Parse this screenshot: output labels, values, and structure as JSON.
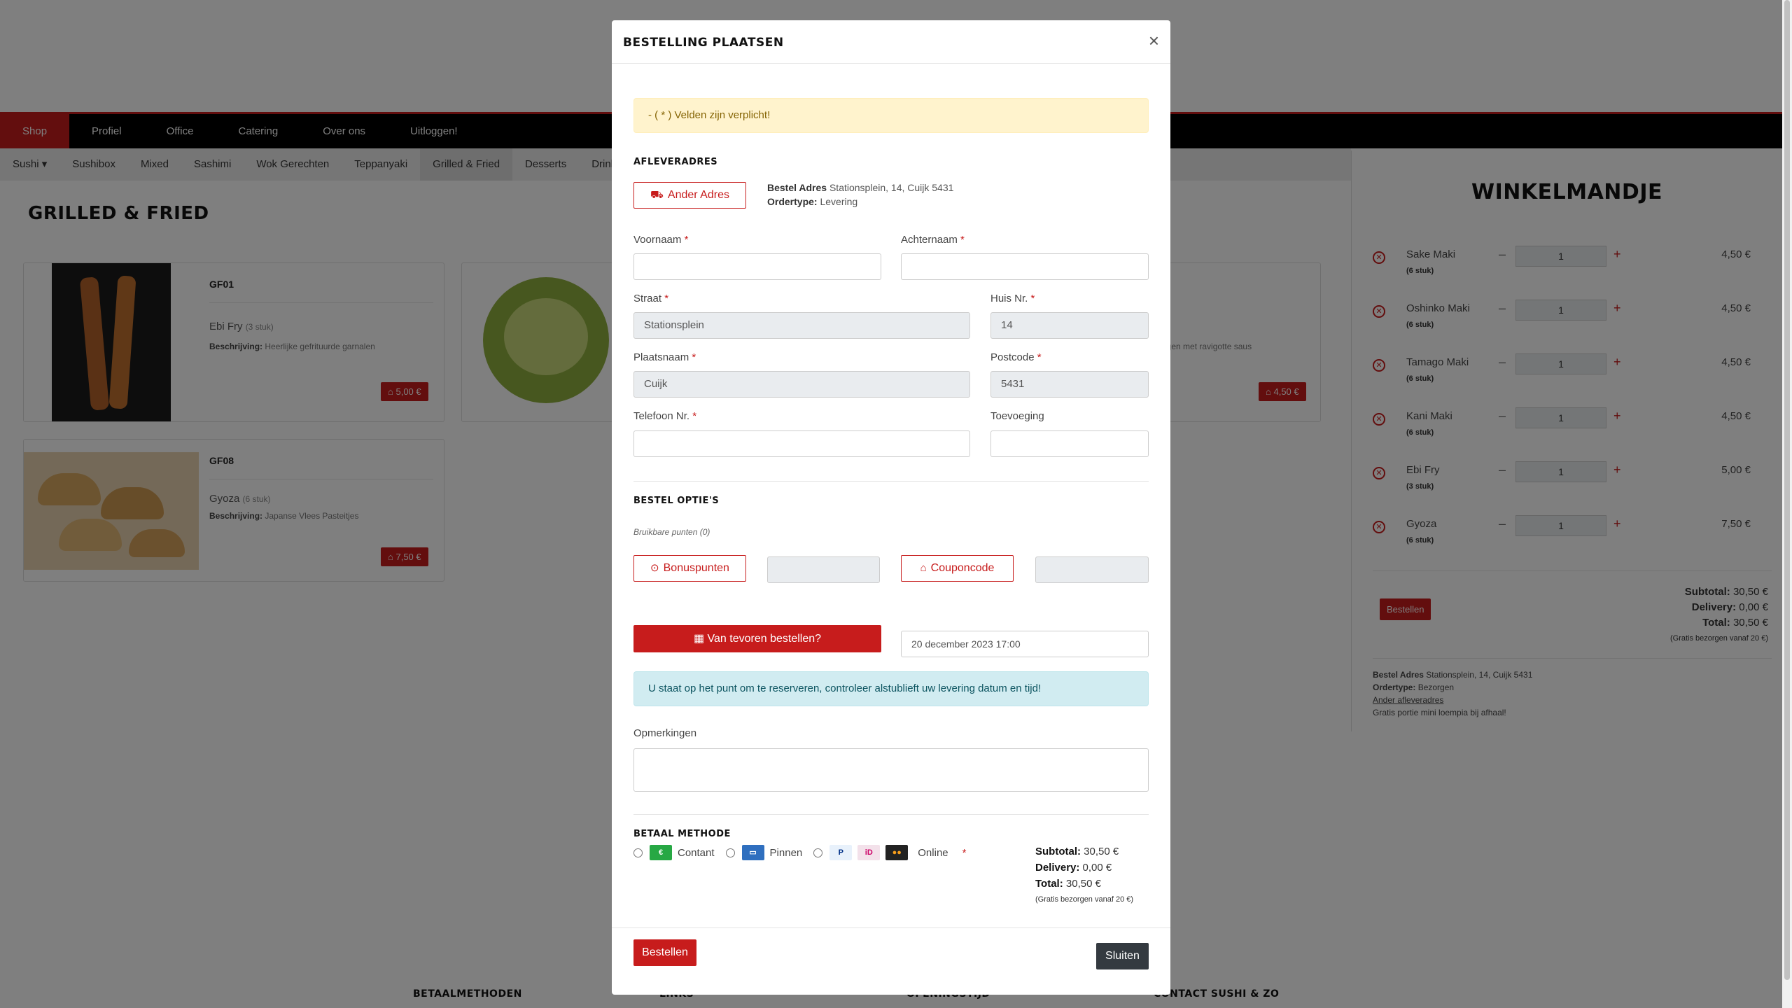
{
  "topnav": [
    "Shop",
    "Profiel",
    "Office",
    "Catering",
    "Over ons",
    "Uitloggen!"
  ],
  "subnav": [
    "Sushi",
    "Sushibox",
    "Mixed",
    "Sashimi",
    "Wok Gerechten",
    "Teppanyaki",
    "Grilled & Fried",
    "Desserts",
    "Drink"
  ],
  "page_title": "GRILLED & FRIED",
  "products": [
    {
      "code": "GF01",
      "name": "Ebi Fry",
      "size": "(3 stuk)",
      "desc_label": "Beschrijving:",
      "desc": "Heerlijke gefrituurde garnalen",
      "price": "5,00 €"
    },
    {
      "code": "GF08",
      "name": "Gyoza",
      "size": "(6 stuk)",
      "desc_label": "Beschrijving:",
      "desc": "Japanse Vlees Pasteitjes",
      "price": "7,50 €"
    },
    {
      "partial_desc": "ngen met ravigotte saus",
      "price": "4,50 €"
    }
  ],
  "cart": {
    "title": "WINKELMANDJE",
    "items": [
      {
        "name": "Sake Maki",
        "size": "(6 stuk)",
        "qty": "1",
        "price": "4,50 €"
      },
      {
        "name": "Oshinko Maki",
        "size": "(6 stuk)",
        "qty": "1",
        "price": "4,50 €"
      },
      {
        "name": "Tamago Maki",
        "size": "(6 stuk)",
        "qty": "1",
        "price": "4,50 €"
      },
      {
        "name": "Kani Maki",
        "size": "(6 stuk)",
        "qty": "1",
        "price": "4,50 €"
      },
      {
        "name": "Ebi Fry",
        "size": "(3 stuk)",
        "qty": "1",
        "price": "5,00 €"
      },
      {
        "name": "Gyoza",
        "size": "(6 stuk)",
        "qty": "1",
        "price": "7,50 €"
      }
    ],
    "order_label": "Bestellen",
    "subtotal_label": "Subtotal:",
    "subtotal": "30,50 €",
    "delivery_label": "Delivery:",
    "delivery": "0,00 €",
    "total_label": "Total:",
    "total": "30,50 €",
    "free_note": "(Gratis bezorgen vanaf 20 €)",
    "addr_label": "Bestel Adres",
    "addr": "Stationsplein, 14, Cuijk 5431",
    "type_label": "Ordertype:",
    "type": "Bezorgen",
    "other_addr": "Ander afleveradres",
    "promo": "Gratis portie mini loempia bij afhaal!"
  },
  "footer": [
    "BETAALMETHODEN",
    "LINKS",
    "OPENINGSTIJD",
    "CONTACT SUSHI & ZO"
  ],
  "modal": {
    "title": "BESTELLING PLAATSEN",
    "close": "×",
    "required_note": "- ( * ) Velden zijn verplicht!",
    "delivery_section": "AFLEVERADRES",
    "other_address_btn": "Ander Adres",
    "addr_label": "Bestel Adres",
    "addr": "Stationsplein, 14, Cuijk 5431",
    "type_label": "Ordertype:",
    "type": "Levering",
    "fields": {
      "voornaam": {
        "label": "Voornaam",
        "value": ""
      },
      "achternaam": {
        "label": "Achternaam",
        "value": ""
      },
      "straat": {
        "label": "Straat",
        "value": "Stationsplein"
      },
      "huisnr": {
        "label": "Huis Nr.",
        "value": "14"
      },
      "plaats": {
        "label": "Plaatsnaam",
        "value": "Cuijk"
      },
      "postcode": {
        "label": "Postcode",
        "value": "5431"
      },
      "telefoon": {
        "label": "Telefoon Nr.",
        "value": ""
      },
      "toevoeging": {
        "label": "Toevoeging",
        "value": ""
      }
    },
    "required_mark": "*",
    "options_section": "BESTEL OPTIE'S",
    "points_note": "Bruikbare punten (0)",
    "bonus_btn": "Bonuspunten",
    "coupon_btn": "Couponcode",
    "preorder_btn": "Van tevoren bestellen?",
    "preorder_date": "20 december 2023 17:00",
    "reserve_info": "U staat op het punt om te reserveren, controleer alstublieft uw levering datum en tijd!",
    "remarks_label": "Opmerkingen",
    "pay_section": "BETAAL METHODE",
    "pay_options": [
      "Contant",
      "Pinnen",
      "Online"
    ],
    "subtotal_label": "Subtotal:",
    "subtotal": "30,50 €",
    "delivery_label": "Delivery:",
    "delivery": "0,00 €",
    "total_label": "Total:",
    "total": "30,50 €",
    "free_note": "(Gratis bezorgen vanaf 20 €)",
    "order_btn": "Bestellen",
    "close_btn": "Sluiten"
  }
}
